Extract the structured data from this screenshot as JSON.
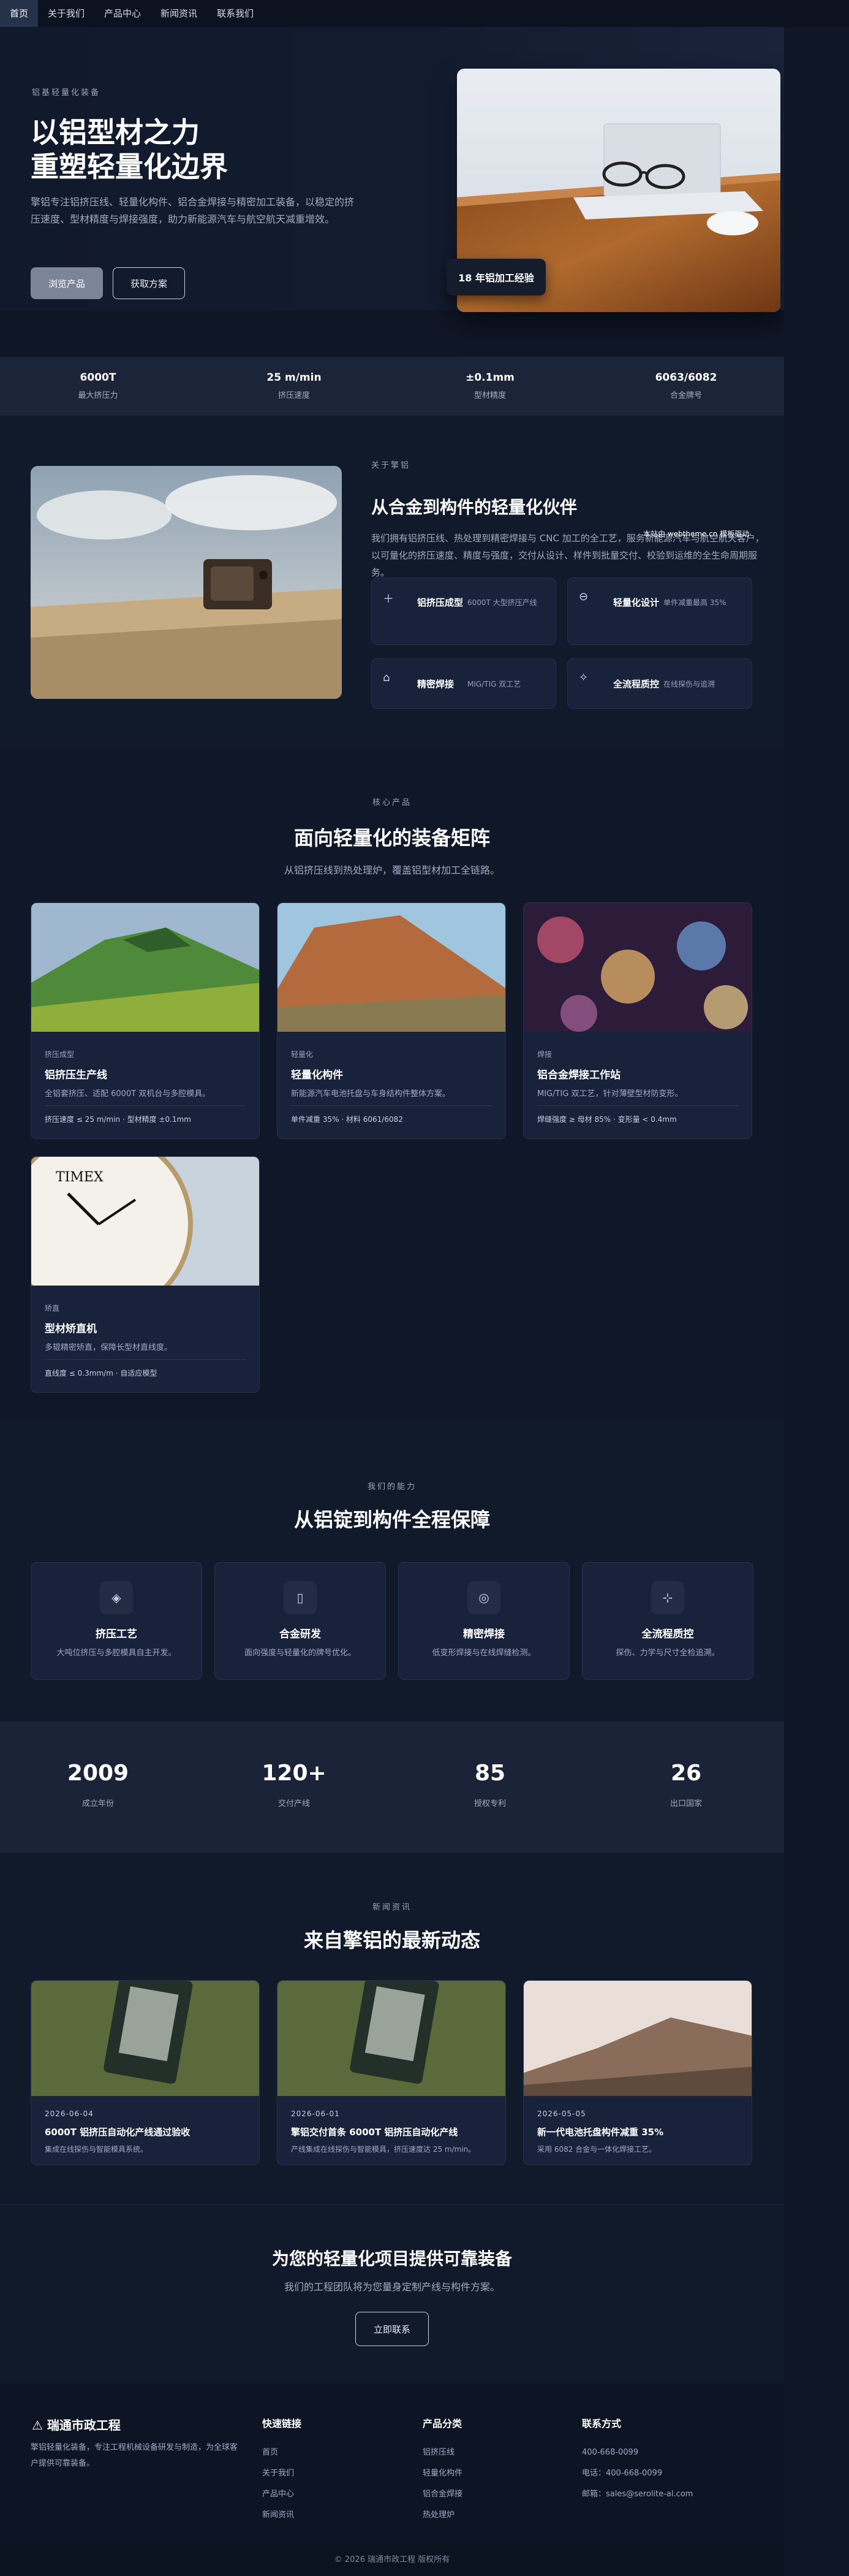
{
  "nav": [
    "首页",
    "关于我们",
    "产品中心",
    "新闻资讯",
    "联系我们"
  ],
  "hero": {
    "eyebrow": "铝基轻量化装备",
    "title1": "以铝型材之力",
    "title2": "重塑轻量化边界",
    "desc": "擎铝专注铝挤压线、轻量化构件、铝合金焊接与精密加工装备，以稳定的挤压速度、型材精度与焊接强度，助力新能源汽车与航空航天减重增效。",
    "primary": "浏览产品",
    "ghost": "获取方案",
    "badge": "18 年铝加工经验"
  },
  "stats": [
    {
      "value": "6000T",
      "label": "最大挤压力"
    },
    {
      "value": "25 m/min",
      "label": "挤压速度"
    },
    {
      "value": "±0.1mm",
      "label": "型材精度"
    },
    {
      "value": "6063/6082",
      "label": "合金牌号"
    }
  ],
  "about": {
    "eyebrow": "关于擎铝",
    "title": "从合金到构件的轻量化伙伴",
    "desc": "我们拥有铝挤压线、热处理到精密焊接与 CNC 加工的全工艺，服务新能源汽车与航空航天客户，以可量化的挤压速度、精度与强度，交付从设计、样件到批量交付、校验到运维的全生命周期服务。",
    "credit": "本站由 webtheme.cn 模板驱动",
    "features": [
      {
        "title": "铝挤压成型",
        "desc": "6000T 大型挤压产线"
      },
      {
        "title": "轻量化设计",
        "desc": "单件减重最高 35%"
      },
      {
        "title": "精密焊接",
        "desc": "MIG/TIG 双工艺"
      },
      {
        "title": "全流程质控",
        "desc": "在线探伤与追溯"
      }
    ]
  },
  "products": {
    "eyebrow": "核心产品",
    "title": "面向轻量化的装备矩阵",
    "sub": "从铝挤压线到热处理炉，覆盖铝型材加工全链路。",
    "items": [
      {
        "tag": "挤压成型",
        "name": "铝挤压生产线",
        "desc": "全铝套挤压、适配 6000T 双机台与多腔模具。",
        "spec": "挤压速度 ≤ 25 m/min · 型材精度 ±0.1mm"
      },
      {
        "tag": "轻量化",
        "name": "轻量化构件",
        "desc": "新能源汽车电池托盘与车身结构件整体方案。",
        "spec": "单件减重 35% · 材料 6061/6082"
      },
      {
        "tag": "焊接",
        "name": "铝合金焊接工作站",
        "desc": "MIG/TIG 双工艺，针对薄壁型材防变形。",
        "spec": "焊缝强度 ≥ 母材 85% · 变形量 < 0.4mm"
      },
      {
        "tag": "矫直",
        "name": "型材矫直机",
        "desc": "多辊精密矫直，保障长型材直线度。",
        "spec": "直线度 ≤ 0.3mm/m · 自适应模型"
      }
    ]
  },
  "caps": {
    "eyebrow": "我们的能力",
    "title": "从铝锭到构件全程保障",
    "items": [
      {
        "icon": "layers-icon",
        "title": "挤压工艺",
        "desc": "大吨位挤压与多腔模具自主开发。"
      },
      {
        "icon": "document-icon",
        "title": "合金研发",
        "desc": "面向强度与轻量化的牌号优化。"
      },
      {
        "icon": "check-circle-icon",
        "title": "精密焊接",
        "desc": "低变形焊接与在线焊缝检测。"
      },
      {
        "icon": "crosshair-icon",
        "title": "全流程质控",
        "desc": "探伤、力学与尺寸全检追溯。"
      }
    ]
  },
  "numbers": [
    {
      "value": "2009",
      "label": "成立年份"
    },
    {
      "value": "120+",
      "label": "交付产线"
    },
    {
      "value": "85",
      "label": "授权专利"
    },
    {
      "value": "26",
      "label": "出口国家"
    }
  ],
  "news": {
    "eyebrow": "新闻资讯",
    "title": "来自擎铝的最新动态",
    "items": [
      {
        "date": "2026-06-04",
        "title": "6000T 铝挤压自动化产线通过验收",
        "desc": "集成在线探伤与智能模具系统。"
      },
      {
        "date": "2026-06-01",
        "title": "擎铝交付首条 6000T 铝挤压自动化产线",
        "desc": "产线集成在线探伤与智能模具，挤压速度达 25 m/min。"
      },
      {
        "date": "2026-05-05",
        "title": "新一代电池托盘构件减重 35%",
        "desc": "采用 6082 合金与一体化焊接工艺。"
      }
    ]
  },
  "cta": {
    "title": "为您的轻量化项目提供可靠装备",
    "sub": "我们的工程团队将为您量身定制产线与构件方案。",
    "button": "立即联系"
  },
  "footer": {
    "brand": "瑞通市政工程",
    "desc": "擎铝轻量化装备，专注工程机械设备研发与制造，为全球客户提供可靠装备。",
    "quick_title": "快速链接",
    "quick": [
      "首页",
      "关于我们",
      "产品中心",
      "新闻资讯"
    ],
    "cat_title": "产品分类",
    "cats": [
      "铝挤压线",
      "轻量化构件",
      "铝合金焊接",
      "热处理炉"
    ],
    "contact_title": "联系方式",
    "contacts": [
      "400-668-0099",
      "电话：400-668-0099",
      "邮箱：sales@serolite-al.com"
    ],
    "copyright": "© 2026 瑞通市政工程 版权所有"
  }
}
